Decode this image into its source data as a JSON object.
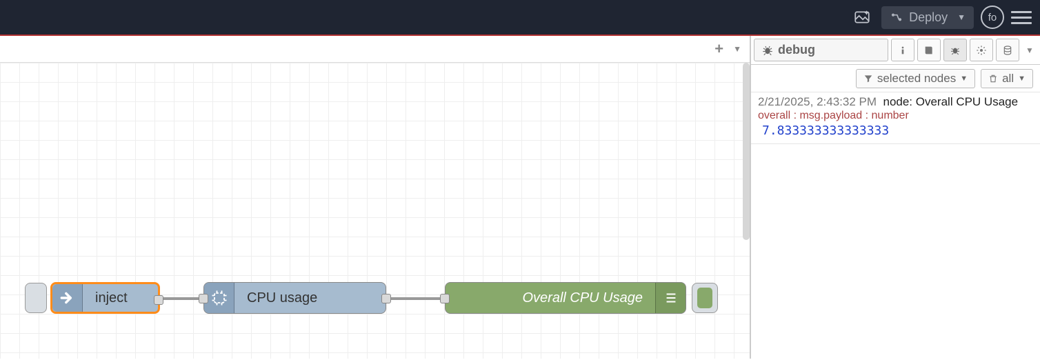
{
  "header": {
    "deploy_label": "Deploy",
    "user_initials": "fo"
  },
  "flow": {
    "nodes": {
      "inject": {
        "label": "inject"
      },
      "cpu": {
        "label": "CPU usage"
      },
      "debug": {
        "label": "Overall CPU Usage"
      }
    }
  },
  "sidebar": {
    "main_tab_label": "debug",
    "filter_label": "selected nodes",
    "all_label": "all",
    "messages": [
      {
        "timestamp": "2/21/2025, 2:43:32 PM",
        "node_prefix": "node: ",
        "node_name": "Overall CPU Usage",
        "topic_line": "overall : msg.payload : number",
        "value": "7.833333333333333"
      }
    ]
  }
}
